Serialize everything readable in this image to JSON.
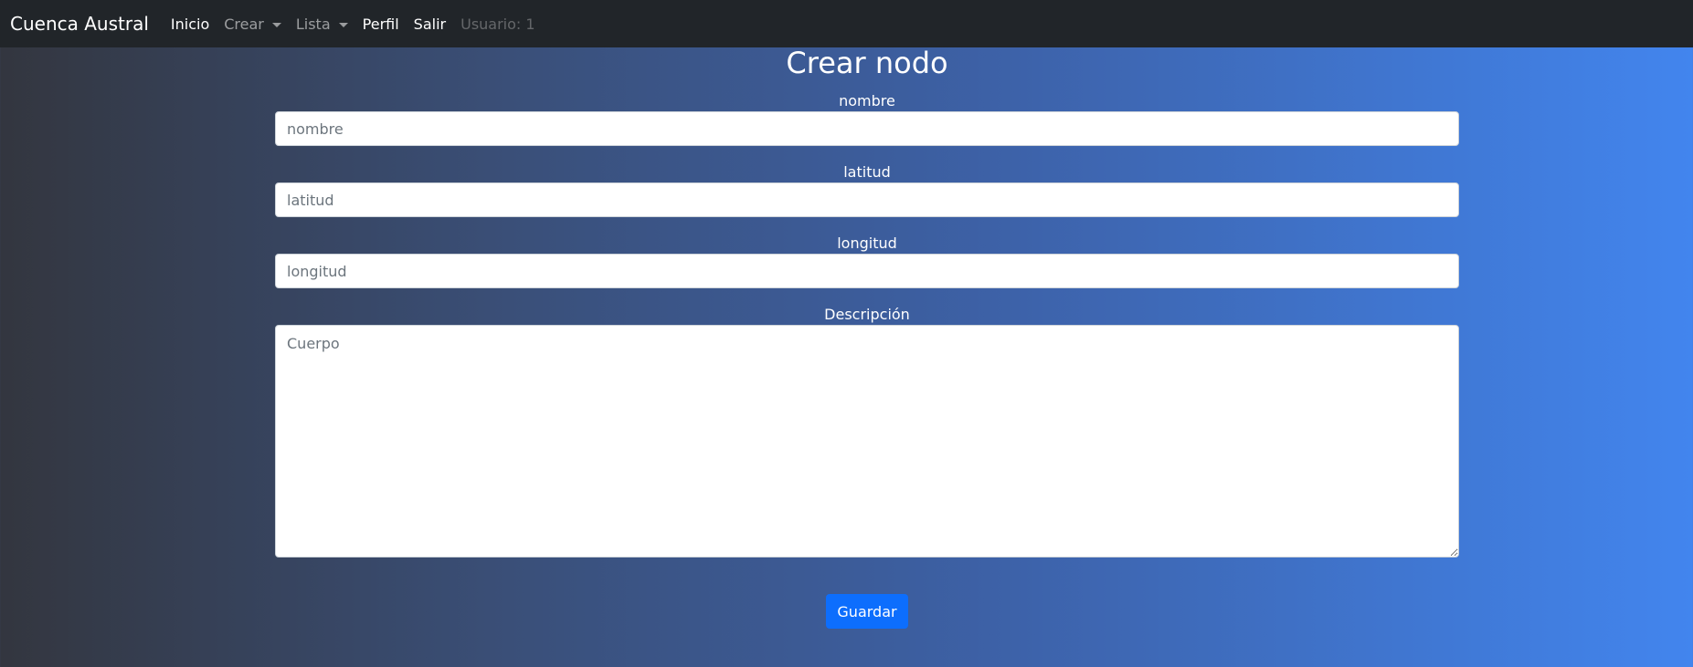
{
  "navbar": {
    "brand": "Cuenca Austral",
    "items": [
      {
        "label": "Inicio"
      },
      {
        "label": "Crear"
      },
      {
        "label": "Lista"
      },
      {
        "label": "Perfil"
      },
      {
        "label": "Salir"
      },
      {
        "label": "Usuario: 1"
      }
    ]
  },
  "main": {
    "title": "Crear nodo",
    "fields": [
      {
        "label": "nombre",
        "placeholder": "nombre",
        "value": ""
      },
      {
        "label": "latitud",
        "placeholder": "latitud",
        "value": ""
      },
      {
        "label": "longitud",
        "placeholder": "longitud",
        "value": ""
      },
      {
        "label": "Descripción",
        "placeholder": "Cuerpo",
        "value": ""
      }
    ],
    "save_label": "Guardar"
  },
  "colors": {
    "navbar_bg": "#212529",
    "button_primary": "#0d6efd",
    "gradient_start": "#33363f",
    "gradient_end": "#4285ee"
  },
  "icons": {
    "dropdown": "caret-down-icon"
  }
}
